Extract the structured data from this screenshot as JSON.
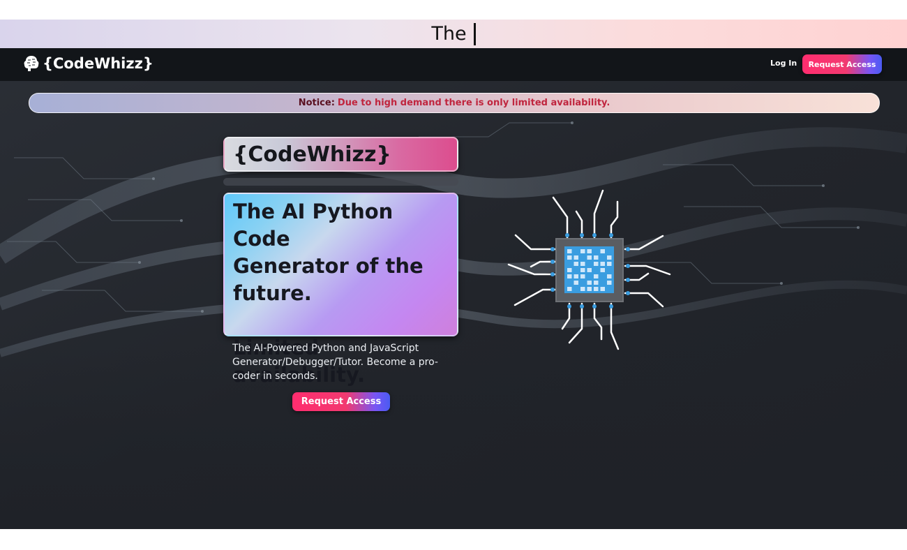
{
  "typing_banner": {
    "text": "The"
  },
  "navbar": {
    "brand": "{CodeWhizz}",
    "brand_icon": "brain-icon",
    "login_label": "Log In",
    "request_access_label": "Request Access"
  },
  "notice": {
    "label": "Notice:",
    "text": "Due to high demand there is only limited availability."
  },
  "hero": {
    "logo_text": "{CodeWhizz}",
    "headline_lines": [
      "The AI Python Code",
      "Generator of the",
      "future."
    ],
    "headline_tagline": "Limited availability.",
    "description": "The AI-Powered Python and JavaScript Generator/Debugger/Tutor. Become a pro-coder in seconds.",
    "cta_label": "Request Access",
    "illustration_icon": "cpu-chip-icon"
  },
  "colors": {
    "page_bg": "#1f2228",
    "navbar_bg": "#121519",
    "accent_pink": "#ff2d6f",
    "accent_blue": "#4a5bf2",
    "notice_text": "#c0253e",
    "chip_blue": "#3a9de0"
  }
}
